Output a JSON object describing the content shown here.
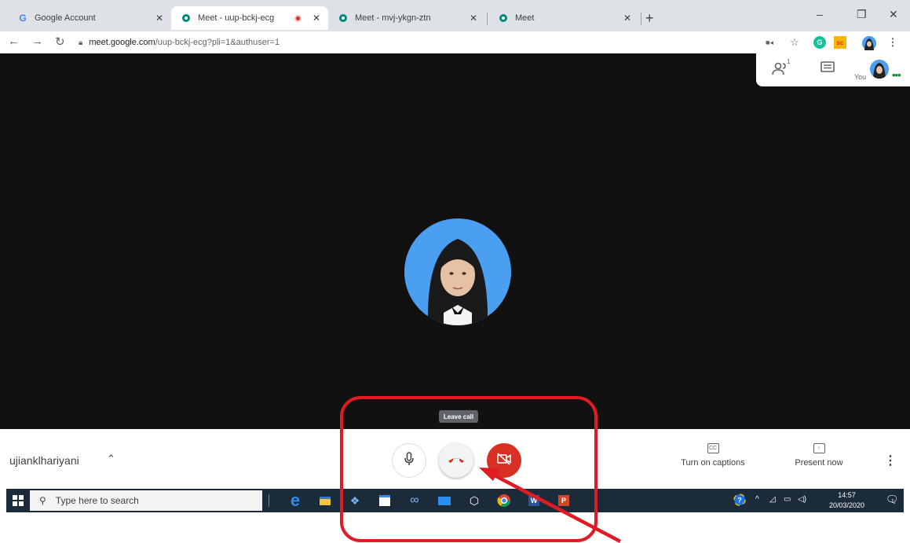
{
  "browser": {
    "tabs": [
      {
        "title": "Google Account",
        "icon": "google-g-icon",
        "active": false
      },
      {
        "title": "Meet - uup-bckj-ecg",
        "icon": "meet-icon",
        "active": true,
        "recording": true
      },
      {
        "title": "Meet - mvj-ykgn-ztn",
        "icon": "meet-icon",
        "active": false
      },
      {
        "title": "Meet",
        "icon": "meet-icon",
        "active": false
      }
    ],
    "url": {
      "domain": "meet.google.com",
      "path": "/uup-bckj-ecg?pli=1&authuser=1"
    },
    "extensions": [
      {
        "name": "camera-icon",
        "glyph": "■◂"
      },
      {
        "name": "star-icon",
        "glyph": "☆"
      },
      {
        "name": "grammarly-icon",
        "glyph": "G"
      },
      {
        "name": "sc-extension-icon",
        "glyph": "sc"
      }
    ],
    "window_controls": {
      "minimize": "–",
      "maximize": "❐",
      "close": "✕"
    },
    "new_tab": "+"
  },
  "meet": {
    "top_right": {
      "participants_badge": "1",
      "you_label": "You"
    },
    "tooltip": "Leave call",
    "meeting_name": "ujianklhariyani",
    "actions": {
      "captions": "Turn on captions",
      "present": "Present now"
    },
    "colors": {
      "background": "#111111",
      "hangup": "#d93025",
      "camera_off": "#d93025",
      "avatar_bg": "#4a9ff0"
    }
  },
  "taskbar": {
    "search_placeholder": "Type here to search",
    "time": "14:57",
    "date": "20/03/2020",
    "notification_count": "1",
    "apps": [
      "edge-icon",
      "file-explorer-icon",
      "dropbox-icon",
      "store-icon",
      "infinity-icon",
      "mail-icon",
      "3d-box-icon",
      "chrome-icon",
      "word-icon",
      "powerpoint-icon"
    ]
  },
  "annotation": {
    "color": "#e01b24"
  }
}
